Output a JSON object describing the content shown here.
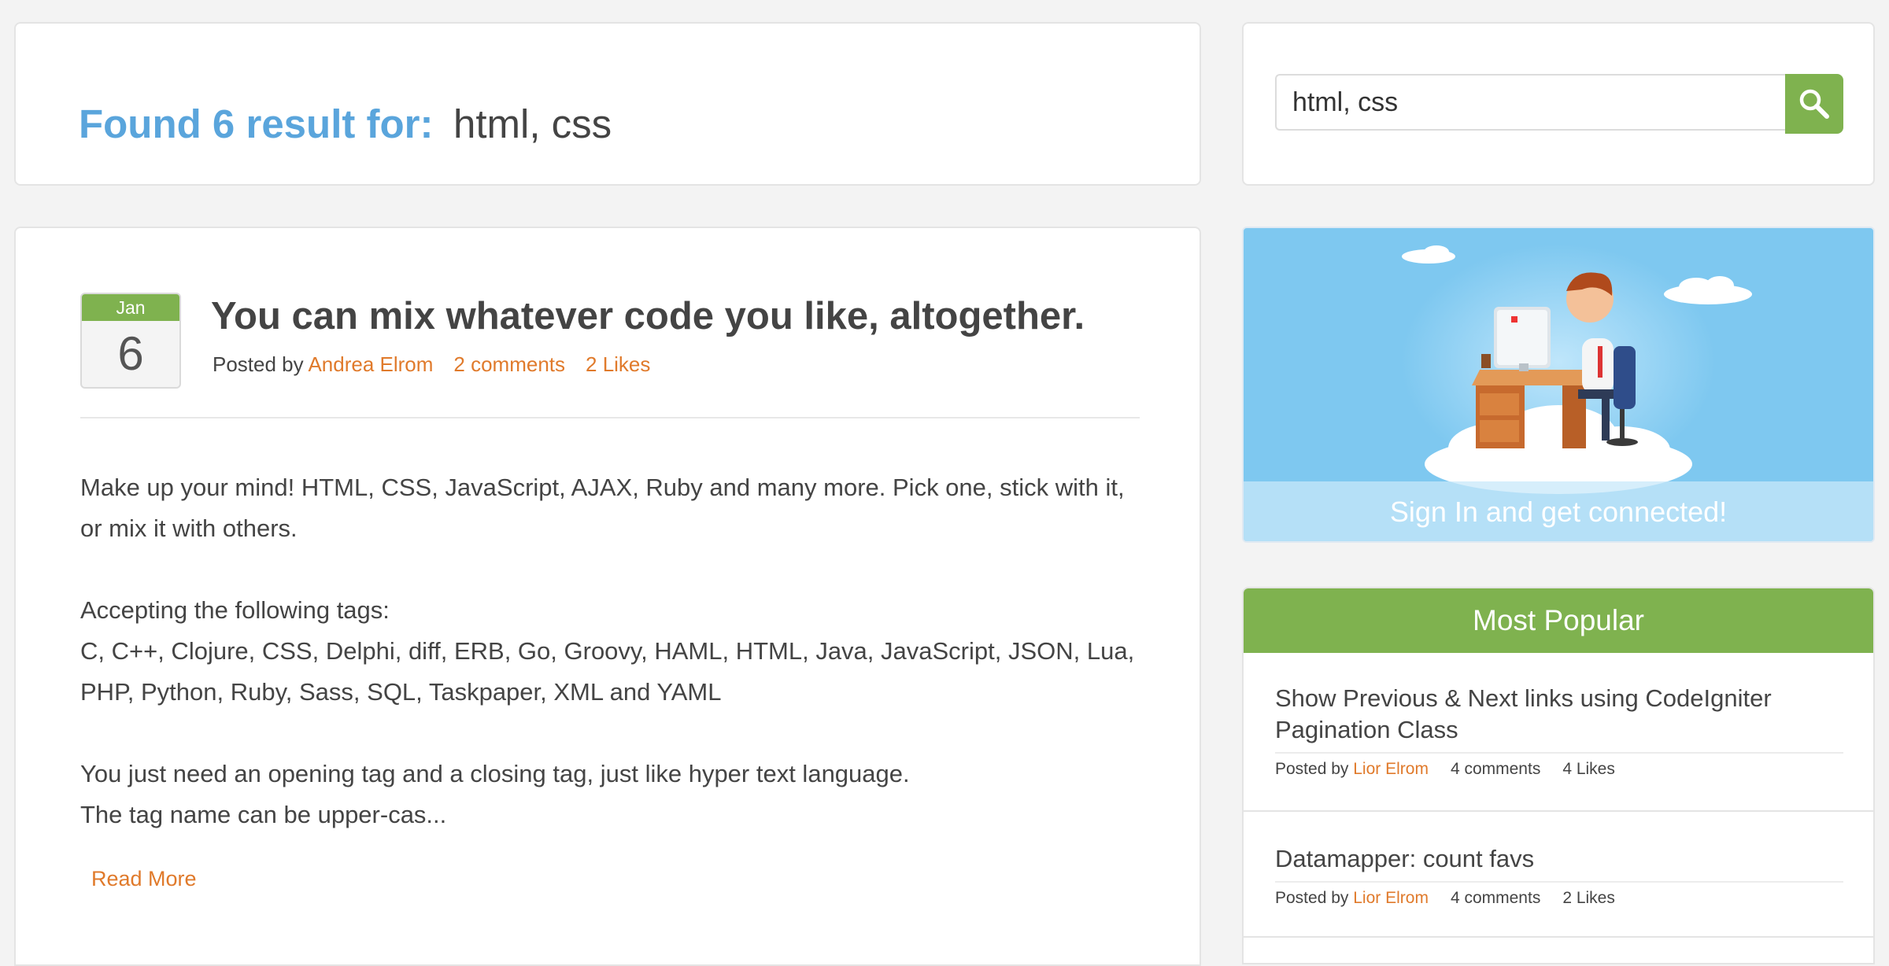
{
  "results": {
    "label": "Found 6 result for:",
    "query": "html, css"
  },
  "search": {
    "value": "html, css",
    "button_icon": "search-icon"
  },
  "post": {
    "month": "Jan",
    "day": "6",
    "title": "You can mix whatever code you like, altogether.",
    "posted_by_label": "Posted by",
    "author": "Andrea Elrom",
    "comments": "2 comments",
    "likes": "2 Likes",
    "paragraph_1": "Make up your mind! HTML, CSS, JavaScript, AJAX, Ruby and many more.  Pick one, stick with it, or mix it with others.",
    "paragraph_2_heading": "Accepting the following tags:",
    "paragraph_2_body": "C, C++, Clojure, CSS, Delphi, diff, ERB, Go, Groovy, HAML, HTML, Java, JavaScript, JSON, Lua, PHP, Python, Ruby, Sass, SQL, Taskpaper, XML and YAML",
    "paragraph_3_line_1": "You just need an opening tag and a closing tag, just like hyper text language.",
    "paragraph_3_line_2": "The tag name can be upper-cas...",
    "read_more": "Read More"
  },
  "signin": {
    "text": "Sign In and get connected!"
  },
  "popular": {
    "title": "Most Popular",
    "items": [
      {
        "title": "Show Previous & Next links using CodeIgniter Pagination Class",
        "posted_by_label": "Posted by",
        "author": "Lior Elrom",
        "comments": "4 comments",
        "likes": "4 Likes"
      },
      {
        "title": "Datamapper: count favs",
        "posted_by_label": "Posted by",
        "author": "Lior Elrom",
        "comments": "4 comments",
        "likes": "2 Likes"
      }
    ]
  },
  "colors": {
    "accent_blue": "#5aa5dc",
    "accent_green": "#7fb24f",
    "link_orange": "#e07a2b"
  }
}
